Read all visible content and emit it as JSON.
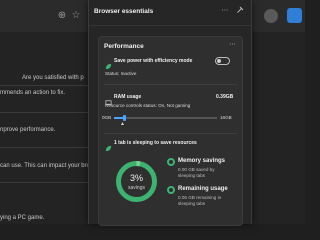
{
  "background": {
    "lines": [
      "Are you satisfied with p",
      "mmends an action to fix.",
      "nprove performance.",
      "can use. This can impact your bro",
      "ying a PC game."
    ]
  },
  "panel": {
    "title": "Browser essentials",
    "card_title": "Performance",
    "efficiency": {
      "label": "Save power with efficiency mode",
      "status": "Status: Inactive",
      "enabled": false
    },
    "ram": {
      "label": "RAM usage",
      "value": "0.39GB",
      "controls_status": "Resource controls status: On, Not gaming",
      "min_label": "0GB",
      "max_label": "16GB",
      "fraction": 0.03
    },
    "sleeping": {
      "label": "1 tab is sleeping to save resources"
    },
    "savings": {
      "percent_text": "3%",
      "caption": "savings",
      "fraction": 0.03,
      "memory": {
        "title": "Memory savings",
        "line1": "0.00 GB saved by",
        "line2": "sleeping tabs"
      },
      "remaining": {
        "title": "Remaining usage",
        "line1": "0.05 GB remaining in",
        "line2": "sleeping tabs"
      }
    },
    "colors": {
      "accent": "#4aa3ff",
      "green": "#3cb371",
      "green_light": "#7fd08e"
    }
  }
}
